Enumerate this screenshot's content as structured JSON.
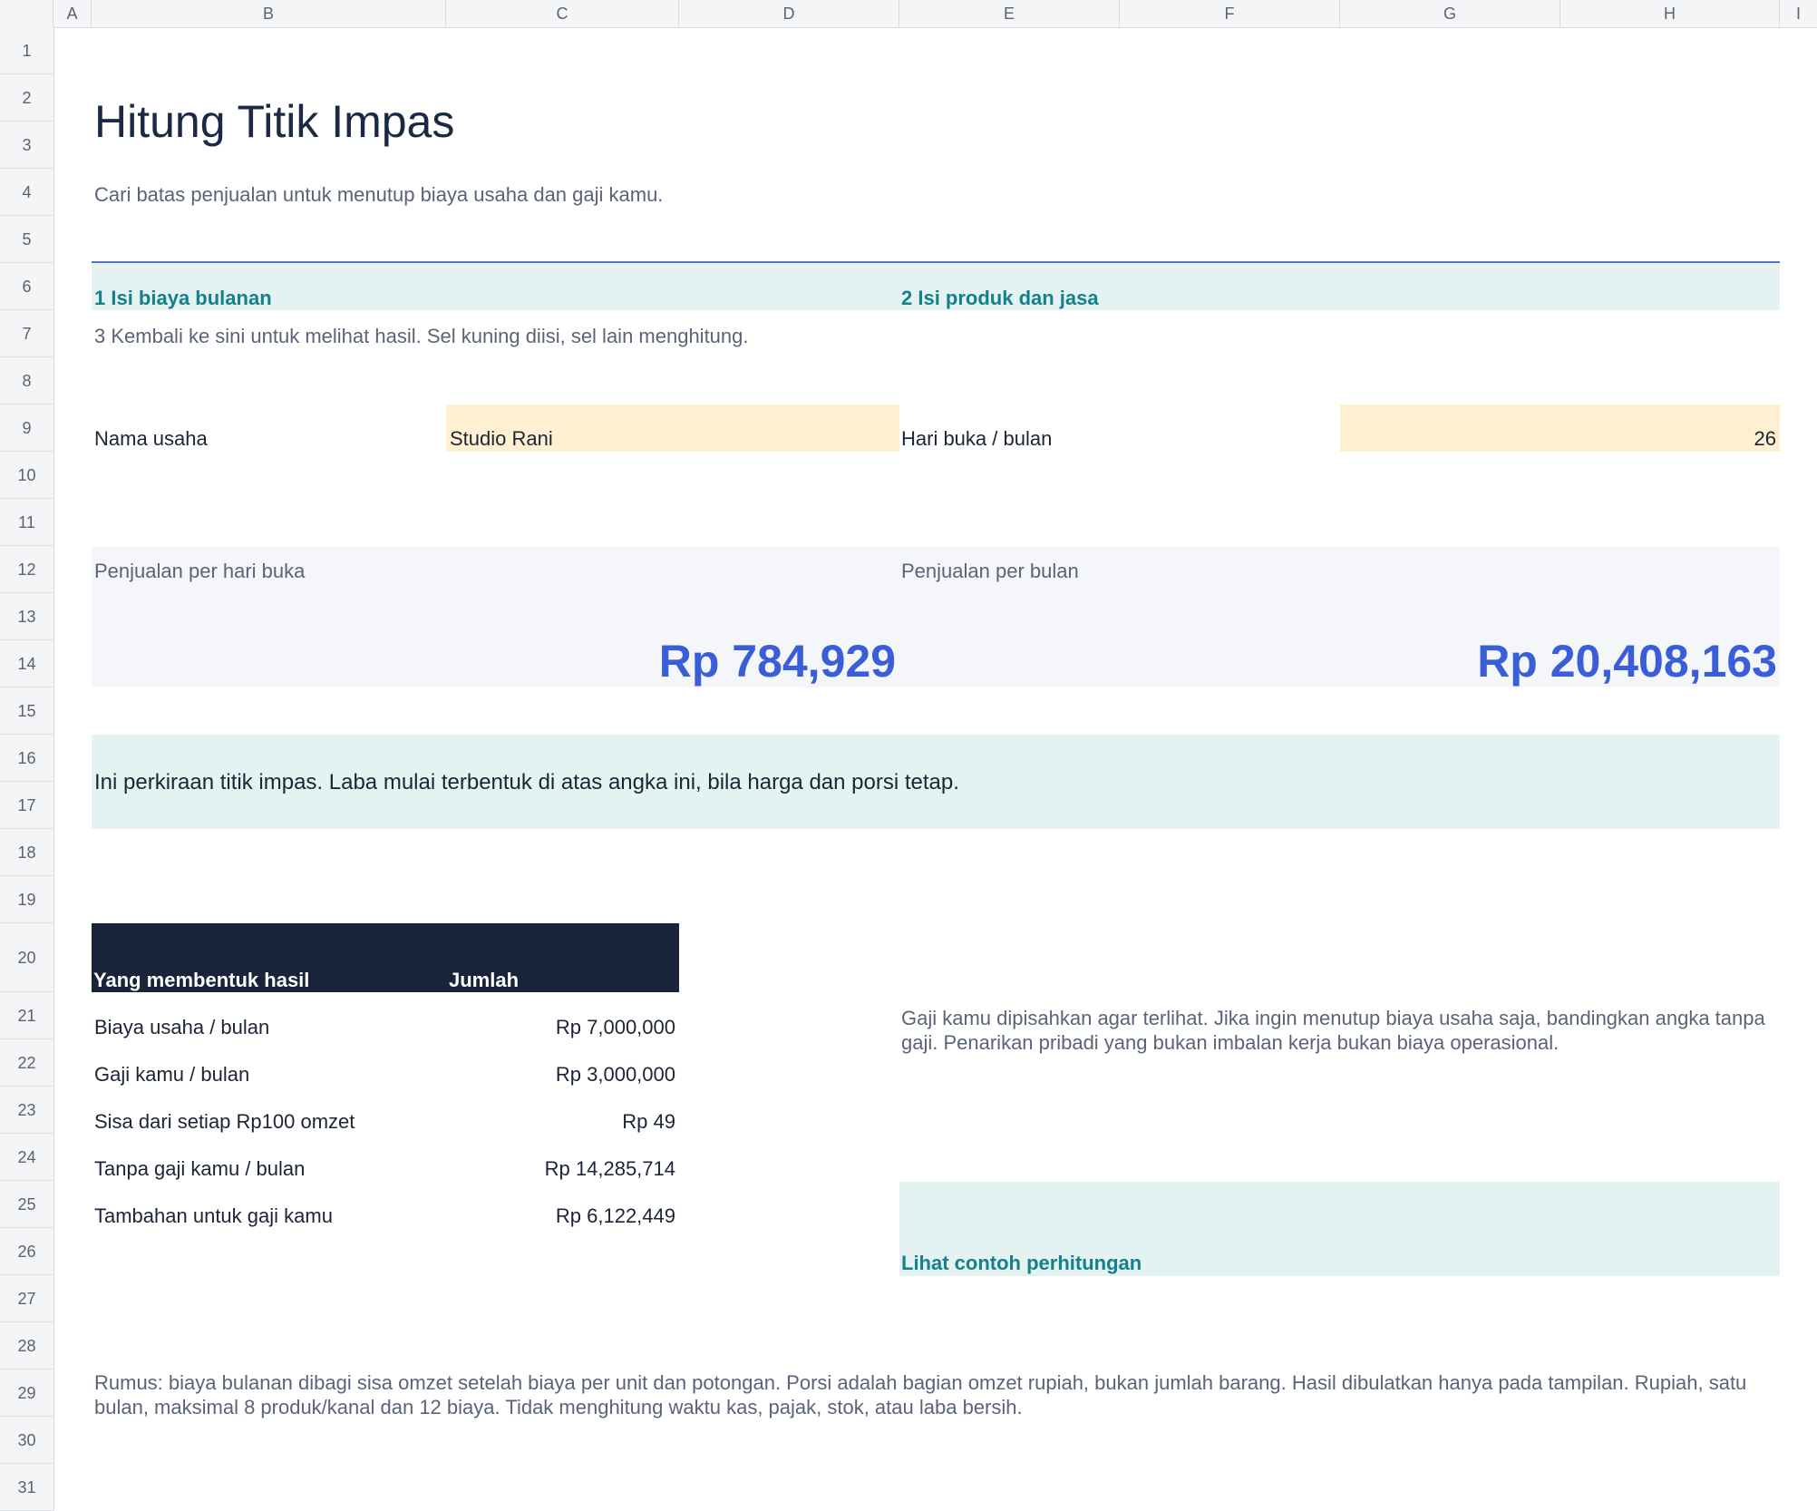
{
  "columns": [
    "A",
    "B",
    "C",
    "D",
    "E",
    "F",
    "G",
    "H",
    "I"
  ],
  "rows": [
    "1",
    "2",
    "3",
    "4",
    "5",
    "6",
    "7",
    "8",
    "9",
    "10",
    "11",
    "12",
    "13",
    "14",
    "15",
    "16",
    "17",
    "18",
    "19",
    "20",
    "21",
    "22",
    "23",
    "24",
    "25",
    "26",
    "27",
    "28",
    "29",
    "30",
    "31"
  ],
  "header": {
    "title": "Hitung Titik Impas",
    "subtitle": "Cari batas penjualan untuk menutup biaya usaha dan gaji kamu."
  },
  "steps": {
    "step1": "1  Isi biaya bulanan",
    "step2": "2  Isi produk dan jasa",
    "step3": "3  Kembali ke sini untuk melihat hasil. Sel kuning diisi, sel lain menghitung."
  },
  "inputs": {
    "business_name_label": "Nama usaha",
    "business_name_value": "Studio Rani",
    "open_days_label": "Hari buka / bulan",
    "open_days_value": "26"
  },
  "results": {
    "per_day_label": "Penjualan per hari buka",
    "per_day_value": "Rp 784,929",
    "per_month_label": "Penjualan per bulan",
    "per_month_value": "Rp 20,408,163"
  },
  "note": "Ini perkiraan titik impas. Laba mulai terbentuk di atas angka ini, bila harga dan porsi tetap.",
  "breakdown": {
    "header_label": "Yang membentuk hasil",
    "header_amount": "Jumlah",
    "rows": [
      {
        "label": "Biaya usaha / bulan",
        "amount": "Rp 7,000,000"
      },
      {
        "label": "Gaji kamu / bulan",
        "amount": "Rp 3,000,000"
      },
      {
        "label": "Sisa dari setiap Rp100 omzet",
        "amount": "Rp 49"
      },
      {
        "label": "Tanpa gaji kamu / bulan",
        "amount": "Rp 14,285,714"
      },
      {
        "label": "Tambahan untuk gaji kamu",
        "amount": "Rp 6,122,449"
      }
    ]
  },
  "side_note": "Gaji kamu dipisahkan agar terlihat. Jika ingin menutup biaya usaha saja, bandingkan angka tanpa gaji. Penarikan pribadi yang bukan imbalan kerja bukan biaya operasional.",
  "example_link": "Lihat contoh perhitungan",
  "formula": "Rumus: biaya bulanan dibagi sisa omzet setelah biaya per unit dan potongan. Porsi adalah bagian omzet rupiah, bukan jumlah barang. Hasil dibulatkan hanya pada tampilan. Rupiah, satu bulan, maksimal 8 produk/kanal dan 12 biaya. Tidak menghitung waktu kas, pajak, stok, atau laba bersih.",
  "colors": {
    "accent_blue": "#3a5ed8",
    "teal": "#13808a",
    "input_yellow": "#fff0d2",
    "table_header": "#19233a"
  }
}
